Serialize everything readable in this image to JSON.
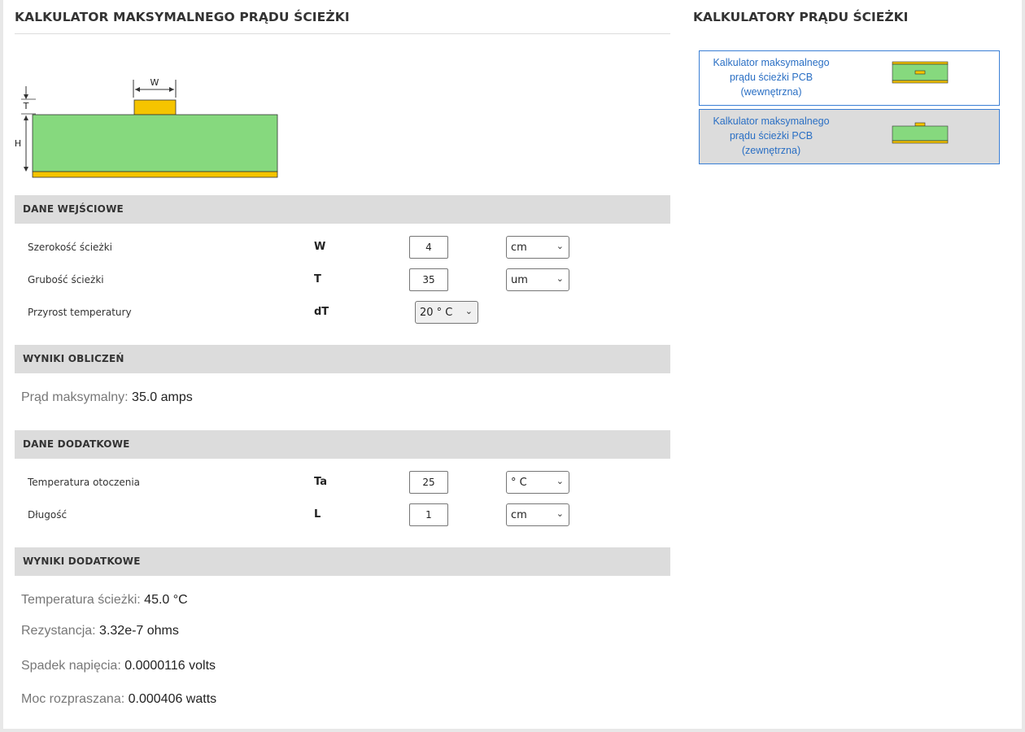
{
  "page": {
    "title": "KALKULATOR MAKSYMALNEGO PRĄDU ŚCIEŻKI"
  },
  "diagram": {
    "label_w": "W",
    "label_t": "T",
    "label_h": "H",
    "colors": {
      "substrate": "#86d97e",
      "copper": "#f5c400"
    }
  },
  "inputs": {
    "header": "DANE WEJŚCIOWE",
    "rows": [
      {
        "label": "Szerokość ścieżki",
        "symbol": "W",
        "value": "4",
        "unit": "cm"
      },
      {
        "label": "Grubość ścieżki",
        "symbol": "T",
        "value": "35",
        "unit": "um"
      },
      {
        "label": "Przyrost temperatury",
        "symbol": "dT",
        "unit": "20 ° C"
      }
    ]
  },
  "results": {
    "header": "WYNIKI OBLICZEŃ",
    "max_current_label": "Prąd maksymalny:",
    "max_current_value": "35.0 amps"
  },
  "additional_inputs": {
    "header": "DANE DODATKOWE",
    "rows": [
      {
        "label": "Temperatura otoczenia",
        "symbol": "Ta",
        "value": "25",
        "unit": "° C"
      },
      {
        "label": "Długość",
        "symbol": "L",
        "value": "1",
        "unit": "cm"
      }
    ]
  },
  "additional_results": {
    "header": "WYNIKI DODATKOWE",
    "items": [
      {
        "label": "Temperatura ścieżki:",
        "value": "45.0 °C"
      },
      {
        "label": "Rezystancja:",
        "value": "3.32e-7 ohms"
      },
      {
        "label": "Spadek napięcia:",
        "value": "0.0000116 volts"
      },
      {
        "label": "Moc rozpraszana:",
        "value": "0.000406 watts"
      }
    ]
  },
  "sidebar": {
    "title": "KALKULATORY PRĄDU ŚCIEŻKI",
    "cards": [
      {
        "line1": "Kalkulator maksymalnego",
        "line2": "prądu ścieżki PCB",
        "line3": "(wewnętrzna)",
        "active": false
      },
      {
        "line1": "Kalkulator maksymalnego",
        "line2": "prądu ścieżki PCB",
        "line3": "(zewnętrzna)",
        "active": true
      }
    ]
  },
  "icons": {
    "select_chevron": "chevron-down-icon"
  }
}
